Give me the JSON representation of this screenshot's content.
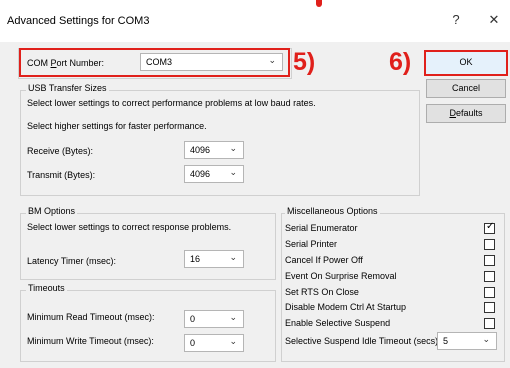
{
  "window": {
    "title": "Advanced Settings for COM3",
    "help_icon": "?",
    "close_icon": "✕"
  },
  "annotations": {
    "step5": "5)",
    "step6": "6)"
  },
  "com_port": {
    "label_pre": "COM ",
    "label_ul": "P",
    "label_post": "ort Number:",
    "value": "COM3"
  },
  "usb": {
    "title": "USB Transfer Sizes",
    "line1": "Select lower settings to correct performance problems at low baud rates.",
    "line2": "Select higher settings for faster performance.",
    "receive_label": "Receive (Bytes):",
    "receive_value": "4096",
    "transmit_label": "Transmit (Bytes):",
    "transmit_value": "4096"
  },
  "bm": {
    "title": "BM Options",
    "desc": "Select lower settings to correct response problems.",
    "latency_label": "Latency Timer (msec):",
    "latency_value": "16"
  },
  "timeouts": {
    "title": "Timeouts",
    "read_label": "Minimum Read Timeout (msec):",
    "read_value": "0",
    "write_label": "Minimum Write Timeout (msec):",
    "write_value": "0"
  },
  "misc": {
    "title": "Miscellaneous Options",
    "options": [
      {
        "label": "Serial Enumerator",
        "checked": true
      },
      {
        "label": "Serial Printer",
        "checked": false
      },
      {
        "label": "Cancel If Power Off",
        "checked": false
      },
      {
        "label": "Event On Surprise Removal",
        "checked": false
      },
      {
        "label": "Set RTS On Close",
        "checked": false
      },
      {
        "label": "Disable Modem Ctrl At Startup",
        "checked": false
      },
      {
        "label": "Enable Selective Suspend",
        "checked": false
      }
    ],
    "idle_label": "Selective Suspend Idle Timeout (secs):",
    "idle_value": "5"
  },
  "buttons": {
    "ok": "OK",
    "cancel": "Cancel",
    "defaults_ul": "D",
    "defaults_rest": "efaults"
  },
  "colors": {
    "annotation": "#e0201b",
    "ok_border": "#0078d7"
  }
}
